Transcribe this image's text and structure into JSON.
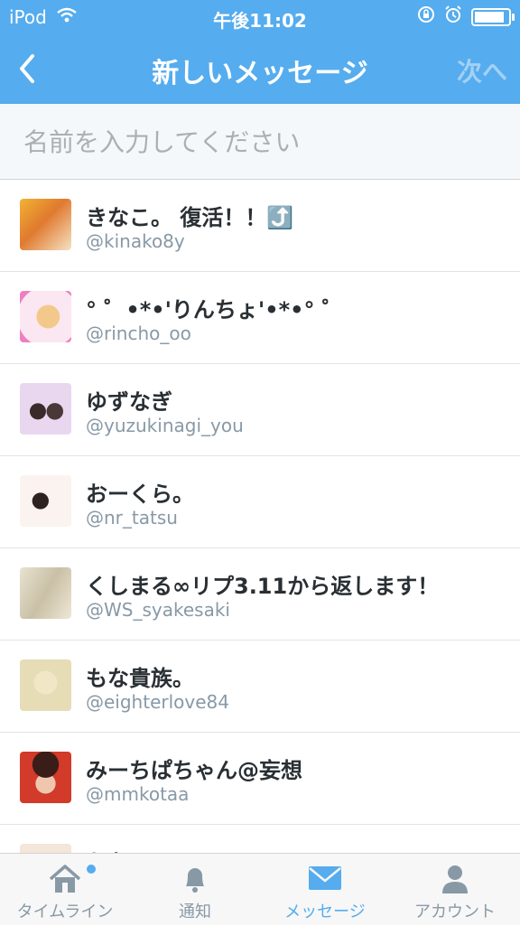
{
  "status_bar": {
    "carrier": "iPod",
    "time": "午後11:02"
  },
  "nav": {
    "title": "新しいメッセージ",
    "next_label": "次へ"
  },
  "search": {
    "placeholder": "名前を入力してください"
  },
  "contacts": [
    {
      "name": "きなこ。 復活！！⤴️",
      "handle": "@kinako8y"
    },
    {
      "name": "° ゜•*•'りんちょ'•*•° ゜",
      "handle": "@rincho_oo"
    },
    {
      "name": "ゆずなぎ",
      "handle": "@yuzukinagi_you"
    },
    {
      "name": "おーくら。",
      "handle": "@nr_tatsu"
    },
    {
      "name": "くしまる∞リプ3.11から返します！",
      "handle": "@WS_syakesaki"
    },
    {
      "name": "もな貴族。",
      "handle": "@eighterlove84"
    },
    {
      "name": "みーちぱちゃん@妄想",
      "handle": "@mmkotaa"
    },
    {
      "name": "かなみ",
      "handle": ""
    }
  ],
  "tabs": [
    {
      "label": "タイムライン",
      "icon": "home-icon",
      "active": false
    },
    {
      "label": "通知",
      "icon": "bell-icon",
      "active": false
    },
    {
      "label": "メッセージ",
      "icon": "envelope-icon",
      "active": true
    },
    {
      "label": "アカウント",
      "icon": "person-icon",
      "active": false
    }
  ],
  "colors": {
    "accent": "#55acee",
    "text": "#292f33",
    "subtext": "#8899a6"
  }
}
